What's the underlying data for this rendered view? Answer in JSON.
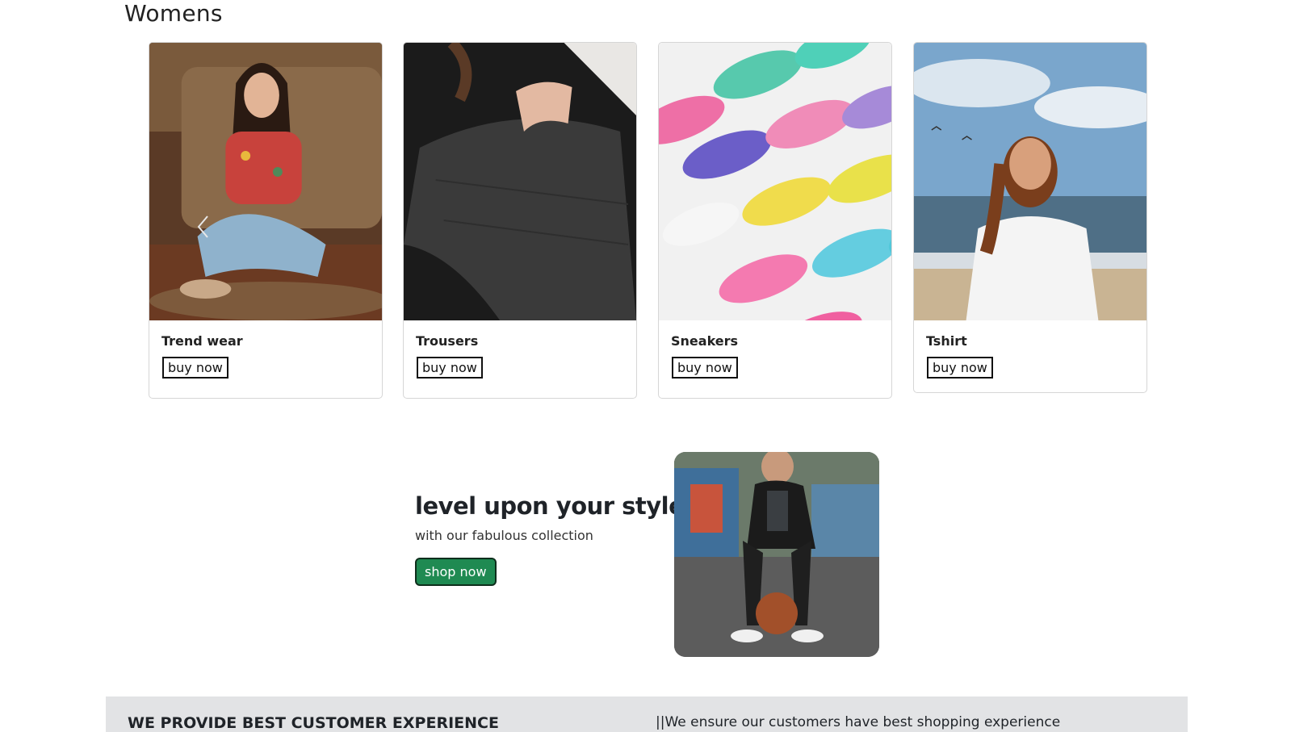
{
  "section": {
    "title": "Womens"
  },
  "products": [
    {
      "name": "Trend wear",
      "button": "buy now"
    },
    {
      "name": "Trousers",
      "button": "buy now"
    },
    {
      "name": "Sneakers",
      "button": "buy now"
    },
    {
      "name": "Tshirt",
      "button": "buy now"
    }
  ],
  "carousel": {
    "prev_icon": "chevron-left-icon"
  },
  "promo": {
    "headline": "level upon your style",
    "subtext": "with our fabulous collection",
    "button": "shop now"
  },
  "banner": {
    "title": "WE PROVIDE BEST CUSTOMER EXPERIENCE",
    "text": "||We ensure our customers have best shopping experience"
  },
  "colors": {
    "accent_button": "#1f8a52",
    "banner_bg": "#e2e3e5",
    "card_border": "#d6d6d6"
  }
}
